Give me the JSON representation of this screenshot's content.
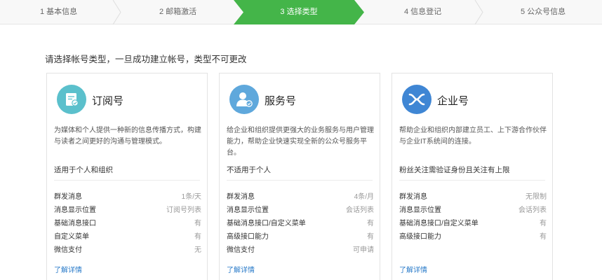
{
  "steps": [
    {
      "label": "1 基本信息"
    },
    {
      "label": "2 邮箱激活"
    },
    {
      "label": "3 选择类型"
    },
    {
      "label": "4 信息登记"
    },
    {
      "label": "5 公众号信息"
    }
  ],
  "intro": "请选择帐号类型，一旦成功建立帐号，类型不可更改",
  "cards": [
    {
      "title": "订阅号",
      "icon": "subscription-icon",
      "desc": "为媒体和个人提供一种新的信息传播方式，构建与读者之间更好的沟通与管理模式。",
      "scope": "适用于个人和组织",
      "features": [
        {
          "name": "群发消息",
          "value": "1条/天"
        },
        {
          "name": "消息显示位置",
          "value": "订阅号列表"
        },
        {
          "name": "基础消息接口",
          "value": "有"
        },
        {
          "name": "自定义菜单",
          "value": "有"
        },
        {
          "name": "微信支付",
          "value": "无"
        }
      ],
      "more": "了解详情"
    },
    {
      "title": "服务号",
      "icon": "service-icon",
      "desc": "给企业和组织提供更强大的业务服务与用户管理能力，帮助企业快速实现全新的公众号服务平台。",
      "scope": "不适用于个人",
      "features": [
        {
          "name": "群发消息",
          "value": "4条/月"
        },
        {
          "name": "消息显示位置",
          "value": "会话列表"
        },
        {
          "name": "基础消息接口/自定义菜单",
          "value": "有"
        },
        {
          "name": "高级接口能力",
          "value": "有"
        },
        {
          "name": "微信支付",
          "value": "可申请"
        }
      ],
      "more": "了解详情"
    },
    {
      "title": "企业号",
      "icon": "enterprise-icon",
      "desc": "帮助企业和组织内部建立员工、上下游合作伙伴与企业IT系统间的连接。",
      "scope": "粉丝关注需验证身份且关注有上限",
      "features": [
        {
          "name": "群发消息",
          "value": "无限制"
        },
        {
          "name": "消息显示位置",
          "value": "会话列表"
        },
        {
          "name": "基础消息接口/自定义菜单",
          "value": "有"
        },
        {
          "name": "高级接口能力",
          "value": "有"
        }
      ],
      "more": "了解详情"
    }
  ],
  "colors": {
    "active_step": "#44b549",
    "subscription_icon": "#5bc0cc",
    "service_icon": "#5fa8dc",
    "enterprise_icon": "#3f86d4",
    "link": "#2a7bc9"
  }
}
